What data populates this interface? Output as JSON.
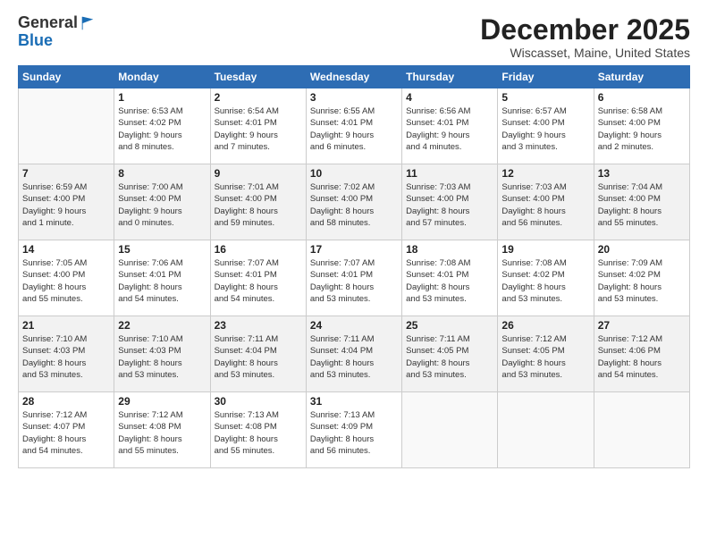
{
  "header": {
    "logo_general": "General",
    "logo_blue": "Blue",
    "month": "December 2025",
    "location": "Wiscasset, Maine, United States"
  },
  "weekdays": [
    "Sunday",
    "Monday",
    "Tuesday",
    "Wednesday",
    "Thursday",
    "Friday",
    "Saturday"
  ],
  "weeks": [
    [
      {
        "day": "",
        "info": ""
      },
      {
        "day": "1",
        "info": "Sunrise: 6:53 AM\nSunset: 4:02 PM\nDaylight: 9 hours\nand 8 minutes."
      },
      {
        "day": "2",
        "info": "Sunrise: 6:54 AM\nSunset: 4:01 PM\nDaylight: 9 hours\nand 7 minutes."
      },
      {
        "day": "3",
        "info": "Sunrise: 6:55 AM\nSunset: 4:01 PM\nDaylight: 9 hours\nand 6 minutes."
      },
      {
        "day": "4",
        "info": "Sunrise: 6:56 AM\nSunset: 4:01 PM\nDaylight: 9 hours\nand 4 minutes."
      },
      {
        "day": "5",
        "info": "Sunrise: 6:57 AM\nSunset: 4:00 PM\nDaylight: 9 hours\nand 3 minutes."
      },
      {
        "day": "6",
        "info": "Sunrise: 6:58 AM\nSunset: 4:00 PM\nDaylight: 9 hours\nand 2 minutes."
      }
    ],
    [
      {
        "day": "7",
        "info": "Sunrise: 6:59 AM\nSunset: 4:00 PM\nDaylight: 9 hours\nand 1 minute."
      },
      {
        "day": "8",
        "info": "Sunrise: 7:00 AM\nSunset: 4:00 PM\nDaylight: 9 hours\nand 0 minutes."
      },
      {
        "day": "9",
        "info": "Sunrise: 7:01 AM\nSunset: 4:00 PM\nDaylight: 8 hours\nand 59 minutes."
      },
      {
        "day": "10",
        "info": "Sunrise: 7:02 AM\nSunset: 4:00 PM\nDaylight: 8 hours\nand 58 minutes."
      },
      {
        "day": "11",
        "info": "Sunrise: 7:03 AM\nSunset: 4:00 PM\nDaylight: 8 hours\nand 57 minutes."
      },
      {
        "day": "12",
        "info": "Sunrise: 7:03 AM\nSunset: 4:00 PM\nDaylight: 8 hours\nand 56 minutes."
      },
      {
        "day": "13",
        "info": "Sunrise: 7:04 AM\nSunset: 4:00 PM\nDaylight: 8 hours\nand 55 minutes."
      }
    ],
    [
      {
        "day": "14",
        "info": "Sunrise: 7:05 AM\nSunset: 4:00 PM\nDaylight: 8 hours\nand 55 minutes."
      },
      {
        "day": "15",
        "info": "Sunrise: 7:06 AM\nSunset: 4:01 PM\nDaylight: 8 hours\nand 54 minutes."
      },
      {
        "day": "16",
        "info": "Sunrise: 7:07 AM\nSunset: 4:01 PM\nDaylight: 8 hours\nand 54 minutes."
      },
      {
        "day": "17",
        "info": "Sunrise: 7:07 AM\nSunset: 4:01 PM\nDaylight: 8 hours\nand 53 minutes."
      },
      {
        "day": "18",
        "info": "Sunrise: 7:08 AM\nSunset: 4:01 PM\nDaylight: 8 hours\nand 53 minutes."
      },
      {
        "day": "19",
        "info": "Sunrise: 7:08 AM\nSunset: 4:02 PM\nDaylight: 8 hours\nand 53 minutes."
      },
      {
        "day": "20",
        "info": "Sunrise: 7:09 AM\nSunset: 4:02 PM\nDaylight: 8 hours\nand 53 minutes."
      }
    ],
    [
      {
        "day": "21",
        "info": "Sunrise: 7:10 AM\nSunset: 4:03 PM\nDaylight: 8 hours\nand 53 minutes."
      },
      {
        "day": "22",
        "info": "Sunrise: 7:10 AM\nSunset: 4:03 PM\nDaylight: 8 hours\nand 53 minutes."
      },
      {
        "day": "23",
        "info": "Sunrise: 7:11 AM\nSunset: 4:04 PM\nDaylight: 8 hours\nand 53 minutes."
      },
      {
        "day": "24",
        "info": "Sunrise: 7:11 AM\nSunset: 4:04 PM\nDaylight: 8 hours\nand 53 minutes."
      },
      {
        "day": "25",
        "info": "Sunrise: 7:11 AM\nSunset: 4:05 PM\nDaylight: 8 hours\nand 53 minutes."
      },
      {
        "day": "26",
        "info": "Sunrise: 7:12 AM\nSunset: 4:05 PM\nDaylight: 8 hours\nand 53 minutes."
      },
      {
        "day": "27",
        "info": "Sunrise: 7:12 AM\nSunset: 4:06 PM\nDaylight: 8 hours\nand 54 minutes."
      }
    ],
    [
      {
        "day": "28",
        "info": "Sunrise: 7:12 AM\nSunset: 4:07 PM\nDaylight: 8 hours\nand 54 minutes."
      },
      {
        "day": "29",
        "info": "Sunrise: 7:12 AM\nSunset: 4:08 PM\nDaylight: 8 hours\nand 55 minutes."
      },
      {
        "day": "30",
        "info": "Sunrise: 7:13 AM\nSunset: 4:08 PM\nDaylight: 8 hours\nand 55 minutes."
      },
      {
        "day": "31",
        "info": "Sunrise: 7:13 AM\nSunset: 4:09 PM\nDaylight: 8 hours\nand 56 minutes."
      },
      {
        "day": "",
        "info": ""
      },
      {
        "day": "",
        "info": ""
      },
      {
        "day": "",
        "info": ""
      }
    ]
  ]
}
